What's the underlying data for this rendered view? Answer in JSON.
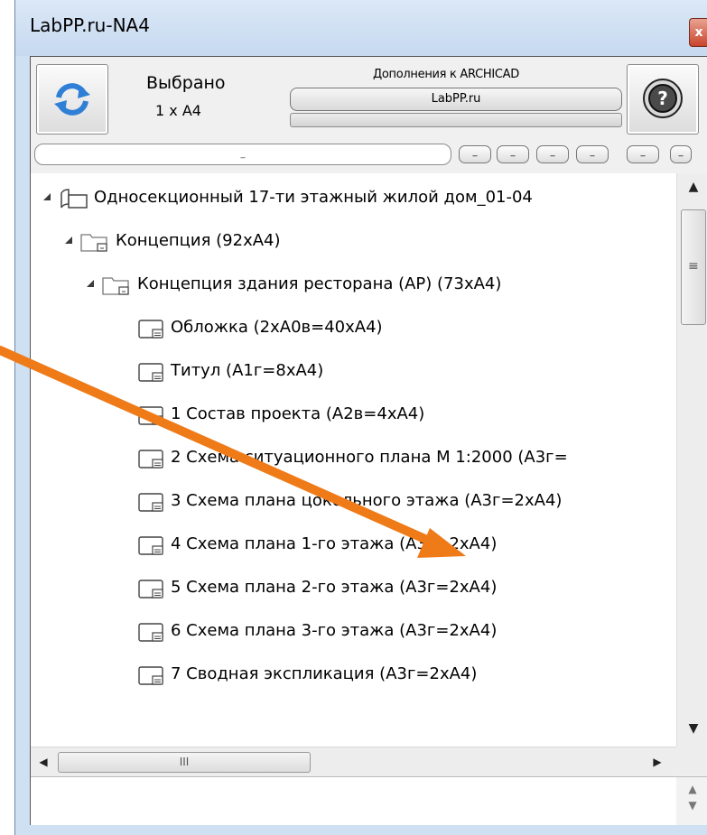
{
  "window": {
    "title": "LabPP.ru-NA4",
    "close_label": "x"
  },
  "toolbar": {
    "selected_label": "Выбрано",
    "selected_count": "1 x A4",
    "addons_label": "Дополнения к ARCHICAD",
    "labpp_button": "LabPP.ru",
    "path_text": "_",
    "mini_buttons": [
      "_",
      "_",
      "_",
      "_",
      "_",
      "_"
    ]
  },
  "tree": {
    "items": [
      {
        "label": "Односекционный 17-ти этажный жилой дом_01-04"
      },
      {
        "label": "Концепция (92xA4)"
      },
      {
        "label": "Концепция  здания ресторана (АР) (73xA4)"
      },
      {
        "label": "Обложка (2xA0в=40xA4)"
      },
      {
        "label": "Титул (A1г=8xA4)"
      },
      {
        "label": "1 Состав проекта (A2в=4xA4)"
      },
      {
        "label": "2 Схема ситуационного  плана М 1:2000 (A3г="
      },
      {
        "label": "3 Схема плана цокольного этажа (A3г=2xA4)"
      },
      {
        "label": "4 Схема плана 1-го этажа (A3г=2xA4)"
      },
      {
        "label": "5 Схема плана 2-го этажа (A3г=2xA4)"
      },
      {
        "label": "6 Схема плана 3-го этажа (A3г=2xA4)"
      },
      {
        "label": "7 Сводная экспликация (A3г=2xA4)"
      }
    ]
  },
  "scrollbar": {
    "h_grip": "III",
    "v_grip": "≡"
  },
  "colors": {
    "accent_arrow": "#ef7a18",
    "refresh_blue": "#2f7fd6"
  }
}
